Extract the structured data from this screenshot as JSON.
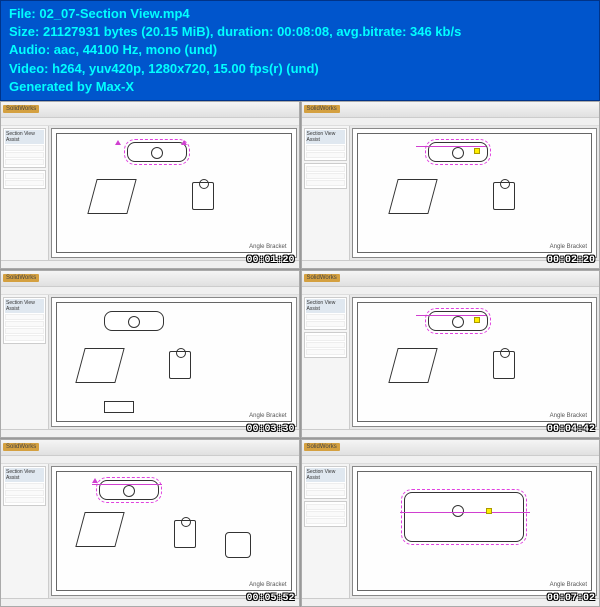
{
  "header": {
    "line1_label": "File:",
    "line1_value": "02_07-Section View.mp4",
    "line2_label": "Size:",
    "line2_value": "21127931 bytes (20.15 MiB), duration: 00:08:08, avg.bitrate: 346 kb/s",
    "line3_label": "Audio:",
    "line3_value": "aac, 44100 Hz, mono (und)",
    "line4_label": "Video:",
    "line4_value": "h264, yuv420p, 1280x720, 15.00 fps(r) (und)",
    "line5": "Generated by Max-X"
  },
  "app_title": "SolidWorks",
  "panel_title": "Section View Assist",
  "sheet_label": "Angle Bracket",
  "thumbs": [
    {
      "timestamp": "00:01:20"
    },
    {
      "timestamp": "00:02:20"
    },
    {
      "timestamp": "00:03:30"
    },
    {
      "timestamp": "00:04:42"
    },
    {
      "timestamp": "00:05:52"
    },
    {
      "timestamp": "00:07:02"
    }
  ]
}
